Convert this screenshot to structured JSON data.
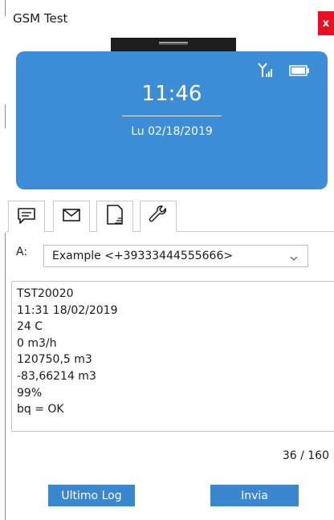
{
  "window": {
    "title": "GSM Test",
    "close_label": "x"
  },
  "status": {
    "time": "11:46",
    "date": "Lu 02/18/2019"
  },
  "tabs": [
    {
      "icon": "message-icon",
      "active": true
    },
    {
      "icon": "envelope-icon",
      "active": false
    },
    {
      "icon": "sim-card-icon",
      "active": false
    },
    {
      "icon": "wrench-icon",
      "active": false
    }
  ],
  "recipient": {
    "label": "A:",
    "value": "Example <+39333444555666>"
  },
  "message": {
    "lines": [
      "TST20020",
      "11:31 18/02/2019",
      "24 C",
      "0 m3/h",
      "120750,5 m3",
      "-83,66214 m3",
      "99%",
      "bq = OK"
    ]
  },
  "counter": "36 / 160",
  "buttons": {
    "log": "Ultimo Log",
    "send": "Invia"
  },
  "colors": {
    "phone_bg": "#3c8dd6",
    "button_bg": "#3a87cf",
    "close_bg": "#e81123"
  }
}
